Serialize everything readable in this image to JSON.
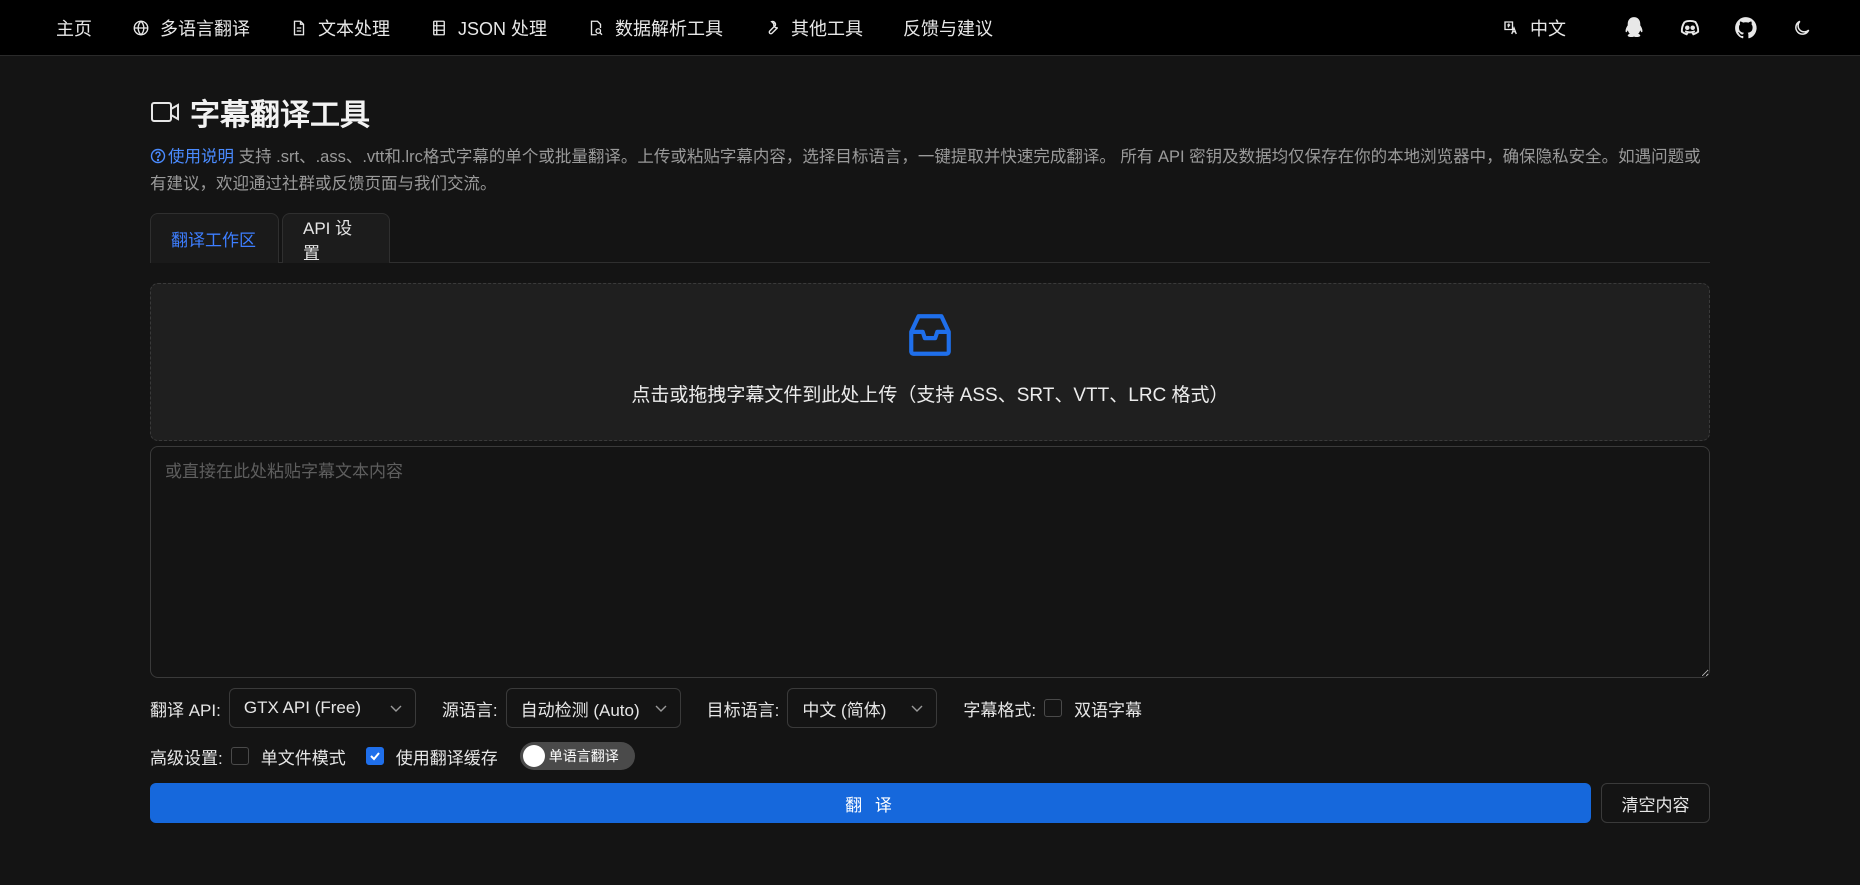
{
  "nav": {
    "items": [
      {
        "label": "主页"
      },
      {
        "label": "多语言翻译"
      },
      {
        "label": "文本处理"
      },
      {
        "label": "JSON 处理"
      },
      {
        "label": "数据解析工具"
      },
      {
        "label": "其他工具"
      },
      {
        "label": "反馈与建议"
      }
    ],
    "language": "中文"
  },
  "page": {
    "title": "字幕翻译工具",
    "help_link": "使用说明",
    "description": " 支持 .srt、.ass、.vtt和.lrc格式字幕的单个或批量翻译。上传或粘贴字幕内容，选择目标语言，一键提取并快速完成翻译。 所有 API 密钥及数据均仅保存在你的本地浏览器中，确保隐私安全。如遇问题或有建议，欢迎通过社群或反馈页面与我们交流。"
  },
  "tabs": [
    {
      "label": "翻译工作区",
      "active": true
    },
    {
      "label": "API 设置",
      "active": false
    }
  ],
  "upload": {
    "text": "点击或拖拽字幕文件到此处上传（支持 ASS、SRT、VTT、LRC 格式）"
  },
  "paste": {
    "placeholder": "或直接在此处粘贴字幕文本内容",
    "value": ""
  },
  "options": {
    "api_label": "翻译 API:",
    "api_value": "GTX API (Free)",
    "source_label": "源语言:",
    "source_value": "自动检测 (Auto)",
    "target_label": "目标语言:",
    "target_value": "中文 (简体)",
    "format_label": "字幕格式:",
    "bilingual_label": "双语字幕",
    "bilingual_checked": false,
    "advanced_label": "高级设置:",
    "single_file_label": "单文件模式",
    "single_file_checked": false,
    "cache_label": "使用翻译缓存",
    "cache_checked": true,
    "toggle_label": "单语言翻译",
    "toggle_on": false
  },
  "actions": {
    "translate_label": "翻 译",
    "clear_label": "清空内容"
  },
  "colors": {
    "accent": "#1668dc",
    "link": "#4a8bff",
    "background": "#141414",
    "nav_background": "#000000"
  },
  "icons": [
    "globe-icon",
    "file-text-icon",
    "json-file-icon",
    "file-search-icon",
    "wrench-icon",
    "translate-icon",
    "qq-icon",
    "discord-icon",
    "github-icon",
    "moon-icon",
    "video-icon",
    "help-circle-icon",
    "inbox-icon",
    "chevron-down-icon",
    "check-icon"
  ]
}
